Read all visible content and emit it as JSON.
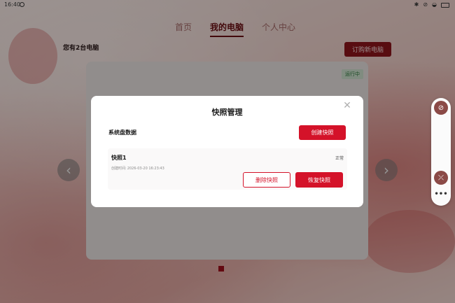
{
  "status_bar": {
    "time": "16:40"
  },
  "nav": {
    "tabs": [
      "首页",
      "我的电脑",
      "个人中心"
    ],
    "active": "我的电脑"
  },
  "computers": {
    "count_text": "您有2台电脑",
    "order_button": "订购新电脑"
  },
  "card": {
    "status": "运行中"
  },
  "modal": {
    "title": "快照管理",
    "section": "系统盘数据",
    "create_button": "创建快照",
    "snapshot": {
      "name": "快照1",
      "status": "正常",
      "created_label": "创建时间:",
      "created_value": "2026-03-20 16:23:43",
      "delete_button": "删除快照",
      "restore_button": "恢复快照"
    }
  },
  "colors": {
    "primary": "#d41229",
    "dark_primary": "#8e151c",
    "running_green": "#2d7a3c"
  }
}
